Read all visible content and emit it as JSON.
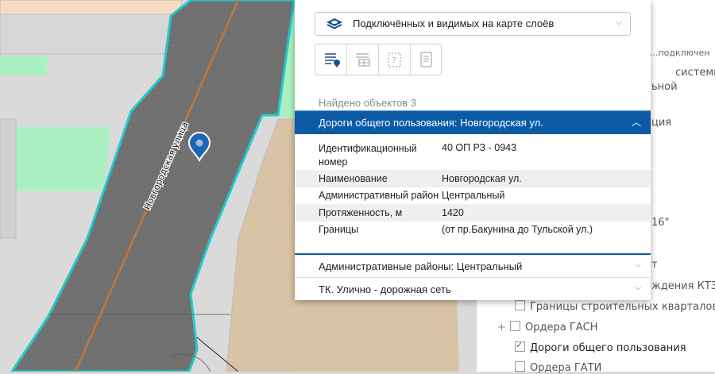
{
  "map": {
    "street_label": "Новгородская улица",
    "colors": {
      "road": "#6f6f6f",
      "road_outline": "#23c9c9",
      "green": "#aaf0c2",
      "beige": "#d8c3a5",
      "empty": "#dadada",
      "centerline": "#c0763c",
      "pin": "#1b64b6"
    },
    "icons": [
      "map-pin-icon"
    ]
  },
  "layer_panel": {
    "items": [
      {
        "text": "...подключен",
        "visible": true
      },
      {
        "text": "системы",
        "visible": true
      },
      {
        "text": "ьной",
        "visible": true
      },
      {
        "text": "ция",
        "visible": true
      },
      {
        "text": "16\"",
        "visible": true
      },
      {
        "text": "т",
        "visible": true
      },
      {
        "text": "ждения КТЗН",
        "visible": true
      }
    ],
    "checkbox_items": [
      {
        "label": "Границы строительных кварталов",
        "checked": false,
        "expand": ""
      },
      {
        "label": "Ордера ГАСН",
        "checked": false,
        "expand": "+"
      },
      {
        "label": "Дороги общего пользования",
        "checked": true,
        "expand": ""
      },
      {
        "label": "Ордера ГАТИ",
        "checked": false,
        "expand": ""
      }
    ]
  },
  "popup": {
    "layer_select": {
      "value": "Подключённых и видимых на карте слоёв",
      "icon": "layers-icon"
    },
    "tools": [
      {
        "name": "list-pin-icon",
        "active": true
      },
      {
        "name": "table-icon",
        "active": false
      },
      {
        "name": "bbox-question-icon",
        "active": false
      },
      {
        "name": "document-icon",
        "active": false
      }
    ],
    "found_text": "Найдено объектов 3",
    "section_title": "Дороги общего пользования: Новгородская ул.",
    "attributes": [
      {
        "key": "Идентификационный номер",
        "key_line1": "Идентификационный",
        "key_line2": "номер",
        "value": "40 ОП РЗ - 0943"
      },
      {
        "key": "Наименование",
        "value": "Новгородская ул."
      },
      {
        "key": "Административный район",
        "value": "Центральный"
      },
      {
        "key": "Протяженность, м",
        "value": "1420"
      },
      {
        "key": "Границы",
        "value": "(от пр.Бакунина до Тульской ул.)"
      }
    ],
    "accordions": [
      {
        "title": "Административные районы: Центральный"
      },
      {
        "title": "ТК. Улично - дорожная сеть"
      }
    ]
  }
}
